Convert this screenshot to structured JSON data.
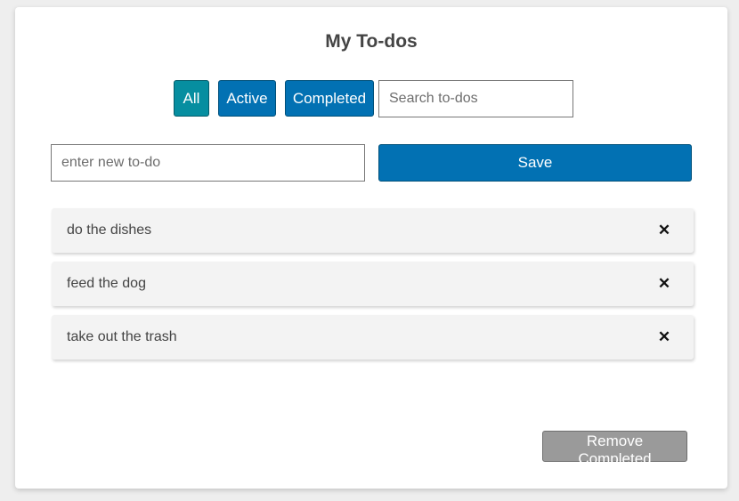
{
  "app": {
    "title": "My To-dos"
  },
  "filters": {
    "all_label": "All",
    "active_label": "Active",
    "completed_label": "Completed",
    "selected": "All"
  },
  "search": {
    "placeholder": "Search to-dos",
    "value": ""
  },
  "new_todo": {
    "placeholder": "enter new to-do",
    "value": "",
    "save_label": "Save"
  },
  "todos": [
    {
      "text": "do the dishes",
      "delete_icon": "close-icon",
      "delete_glyph": "✕"
    },
    {
      "text": "feed the dog",
      "delete_icon": "close-icon",
      "delete_glyph": "✕"
    },
    {
      "text": "take out the trash",
      "delete_icon": "close-icon",
      "delete_glyph": "✕"
    }
  ],
  "footer": {
    "remove_completed_label": "Remove Completed"
  },
  "colors": {
    "primary": "#0271b3",
    "selected_filter": "#068ea0",
    "disabled": "#9a9a9a",
    "item_background": "#f3f3f3"
  }
}
